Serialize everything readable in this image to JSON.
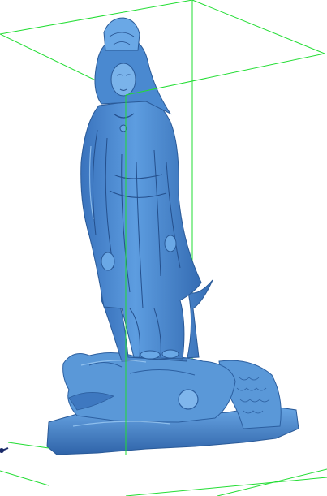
{
  "viewport": {
    "background": "#ffffff",
    "model_color": "#4f8fd3",
    "model_shadow": "#2f63a8",
    "model_highlight": "#8fc0f0",
    "box_color": "#22dd33",
    "axis_color": "#1a2a6a"
  },
  "model": {
    "subject_icon": "standing-statue-on-dragon-fish-base-icon"
  }
}
